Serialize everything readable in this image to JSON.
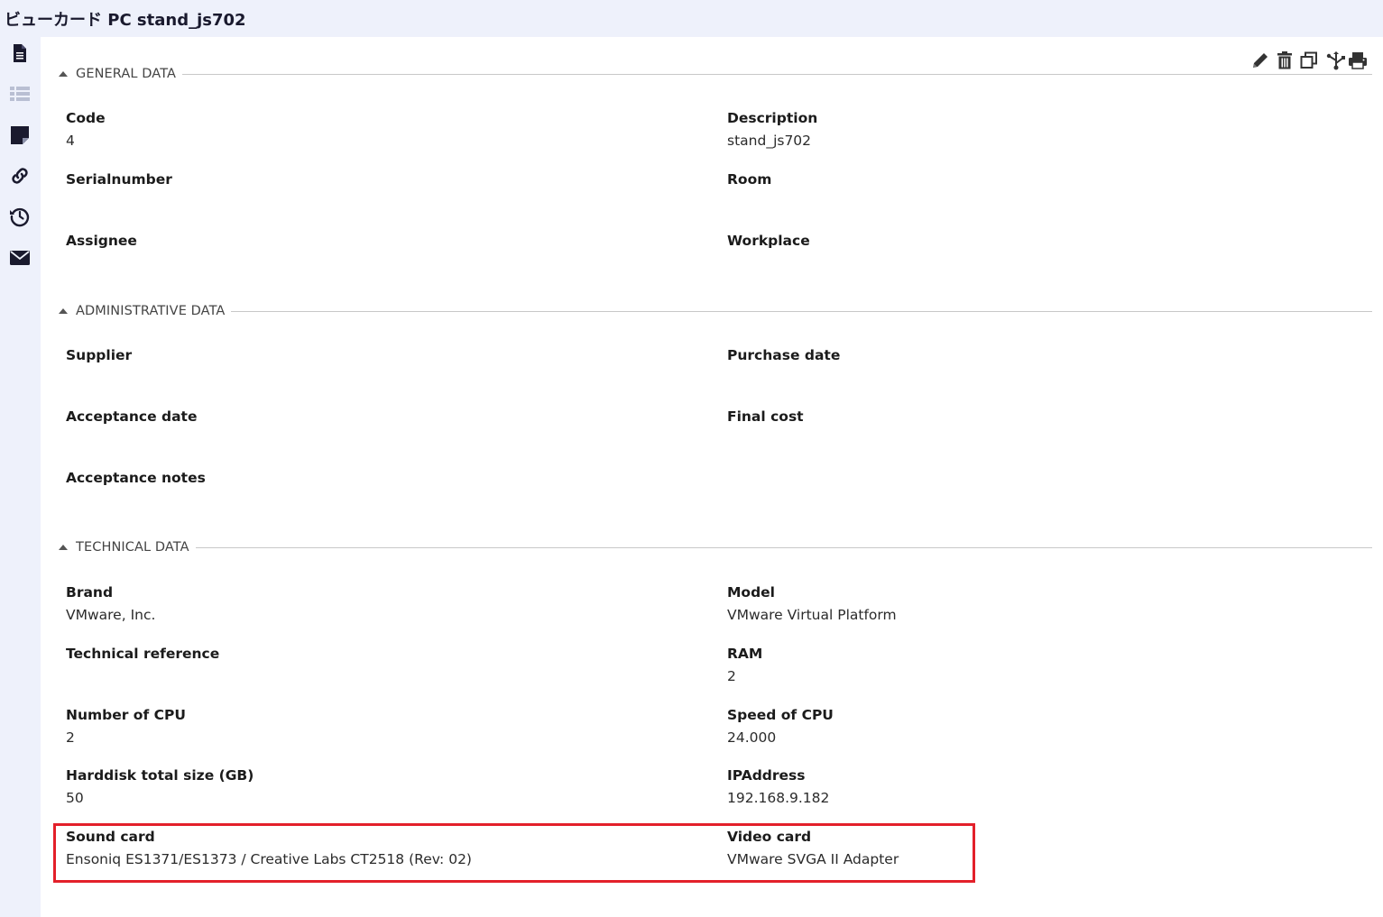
{
  "title": "ビューカード PC stand_js702",
  "sidebar": {
    "items": [
      {
        "icon": "document-icon",
        "active": true
      },
      {
        "icon": "list-icon",
        "active": false
      },
      {
        "icon": "note-icon",
        "active": false
      },
      {
        "icon": "link-icon",
        "active": false
      },
      {
        "icon": "history-icon",
        "active": false
      },
      {
        "icon": "mail-icon",
        "active": false
      }
    ]
  },
  "toolbar": {
    "icons": [
      "pencil-icon",
      "trash-icon",
      "copy-icon",
      "network-icon",
      "print-icon"
    ]
  },
  "sections": {
    "general": {
      "title": "GENERAL DATA",
      "fields": {
        "code": {
          "label": "Code",
          "value": "4"
        },
        "description": {
          "label": "Description",
          "value": "stand_js702"
        },
        "serialnumber": {
          "label": "Serialnumber",
          "value": ""
        },
        "room": {
          "label": "Room",
          "value": ""
        },
        "assignee": {
          "label": "Assignee",
          "value": ""
        },
        "workplace": {
          "label": "Workplace",
          "value": ""
        }
      }
    },
    "administrative": {
      "title": "ADMINISTRATIVE DATA",
      "fields": {
        "supplier": {
          "label": "Supplier",
          "value": ""
        },
        "purchase_date": {
          "label": "Purchase date",
          "value": ""
        },
        "acceptance_date": {
          "label": "Acceptance date",
          "value": ""
        },
        "final_cost": {
          "label": "Final cost",
          "value": ""
        },
        "acceptance_notes": {
          "label": "Acceptance notes",
          "value": ""
        }
      }
    },
    "technical": {
      "title": "TECHNICAL DATA",
      "fields": {
        "brand": {
          "label": "Brand",
          "value": "VMware, Inc."
        },
        "model": {
          "label": "Model",
          "value": "VMware Virtual Platform"
        },
        "technical_reference": {
          "label": "Technical reference",
          "value": ""
        },
        "ram": {
          "label": "RAM",
          "value": "2"
        },
        "number_of_cpu": {
          "label": "Number of CPU",
          "value": "2"
        },
        "speed_of_cpu": {
          "label": "Speed of CPU",
          "value": "24.000"
        },
        "harddisk": {
          "label": "Harddisk total size (GB)",
          "value": "50"
        },
        "ipaddress": {
          "label": "IPAddress",
          "value": "192.168.9.182"
        },
        "sound_card": {
          "label": "Sound card",
          "value": "Ensoniq ES1371/ES1373 / Creative Labs CT2518 (Rev: 02)"
        },
        "video_card": {
          "label": "Video card",
          "value": "VMware SVGA II Adapter"
        }
      }
    }
  },
  "colors": {
    "header_bg": "#eef1fb",
    "icon_active": "#1a1a2e",
    "icon_inactive": "#b9bfd3",
    "highlight": "#e3202a"
  }
}
